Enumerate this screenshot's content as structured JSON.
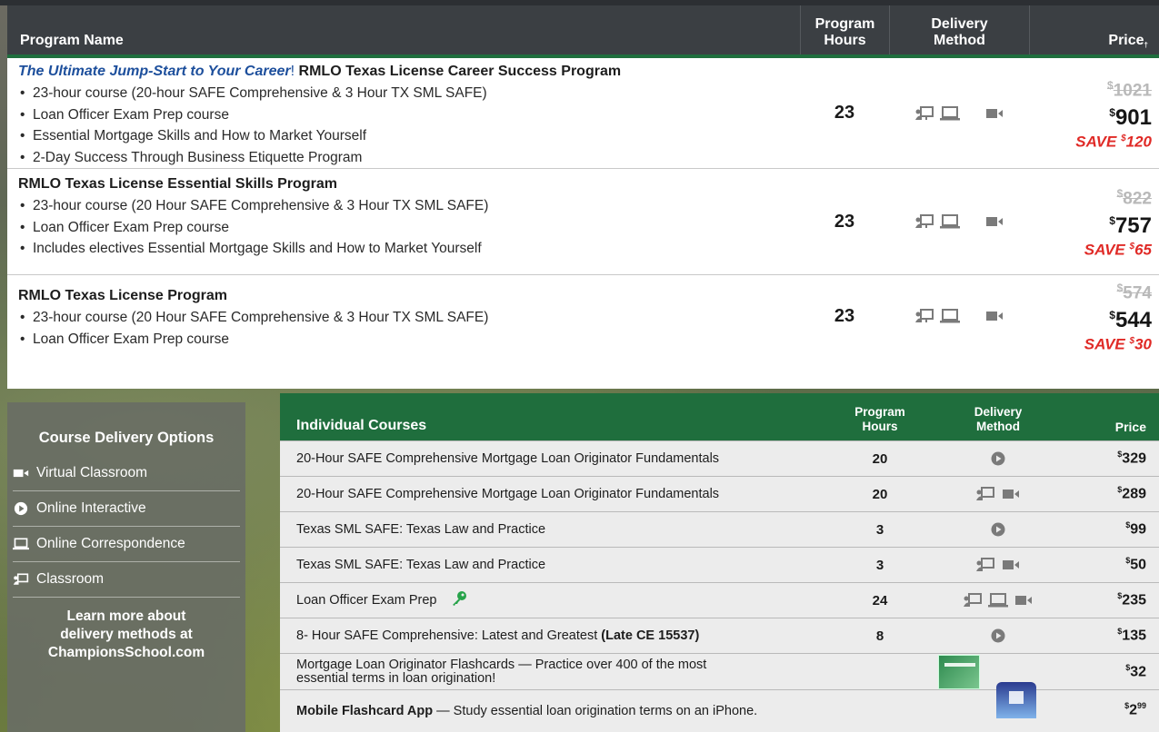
{
  "top_table": {
    "headers": {
      "name": "Program Name",
      "hours_line1": "Program",
      "hours_line2": "Hours",
      "delivery_line1": "Delivery",
      "delivery_line2": "Method",
      "price": "Price",
      "price_mark": "†"
    },
    "programs": [
      {
        "title_highlight": "The Ultimate Jump-Start to Your Career",
        "title_sep": "!",
        "title": "RMLO Texas License Career Success Program",
        "bullets": [
          "23-hour course (20-hour SAFE Comprehensive & 3 Hour TX SML SAFE)",
          "Loan Officer Exam Prep course",
          "Essential Mortgage Skills and How to Market Yourself",
          "2-Day Success Through Business Etiquette Program"
        ],
        "hours": "23",
        "old_price": "1021",
        "new_price": "901",
        "save_label": "SAVE",
        "save_amount": "120"
      },
      {
        "title": "RMLO Texas License Essential Skills Program",
        "bullets": [
          "23-hour course (20 Hour SAFE Comprehensive & 3 Hour TX SML SAFE)",
          "Loan Officer Exam Prep course",
          "Includes electives Essential Mortgage Skills and How to Market Yourself"
        ],
        "hours": "23",
        "old_price": "822",
        "new_price": "757",
        "save_label": "SAVE",
        "save_amount": "65"
      },
      {
        "title": "RMLO Texas License Program",
        "bullets": [
          "23-hour course (20 Hour SAFE Comprehensive & 3 Hour TX SML SAFE)",
          "Loan Officer Exam Prep course"
        ],
        "hours": "23",
        "old_price": "574",
        "new_price": "544",
        "save_label": "SAVE",
        "save_amount": "30"
      }
    ]
  },
  "currency": "$",
  "delivery_panel": {
    "title": "Course Delivery Options",
    "options": [
      "Virtual Classroom",
      "Online Interactive",
      "Online Correspondence",
      "Classroom"
    ],
    "more_line1": "Learn more about",
    "more_line2": "delivery methods at",
    "more_line3": "ChampionsSchool.com"
  },
  "individual": {
    "headers": {
      "name": "Individual Courses",
      "hours_line1": "Program",
      "hours_line2": "Hours",
      "delivery_line1": "Delivery",
      "delivery_line2": "Method",
      "price": "Price"
    },
    "rows": [
      {
        "name": "20-Hour SAFE Comprehensive Mortgage Loan Originator Fundamentals",
        "hours": "20",
        "price": "329"
      },
      {
        "name": "20-Hour SAFE Comprehensive Mortgage Loan Originator Fundamentals",
        "hours": "20",
        "price": "289"
      },
      {
        "name": "Texas SML SAFE: Texas Law and Practice",
        "hours": "3",
        "price": "99"
      },
      {
        "name": "Texas SML SAFE: Texas Law and Practice",
        "hours": "3",
        "price": "50"
      },
      {
        "name": "Loan Officer Exam Prep",
        "hours": "24",
        "price": "235"
      },
      {
        "name": "8- Hour SAFE Comprehensive: Latest and Greatest",
        "name_bold": "(Late CE 15537)",
        "hours": "8",
        "price": "135"
      },
      {
        "name_line1": "Mortgage Loan Originator Flashcards — Practice over 400 of the most",
        "name_line2": "essential terms in loan origination!",
        "price": "32"
      },
      {
        "name_bold": "Mobile Flashcard App",
        "name": " — Study essential loan origination terms on an iPhone.",
        "price": "2",
        "price_cents": "99"
      }
    ]
  }
}
